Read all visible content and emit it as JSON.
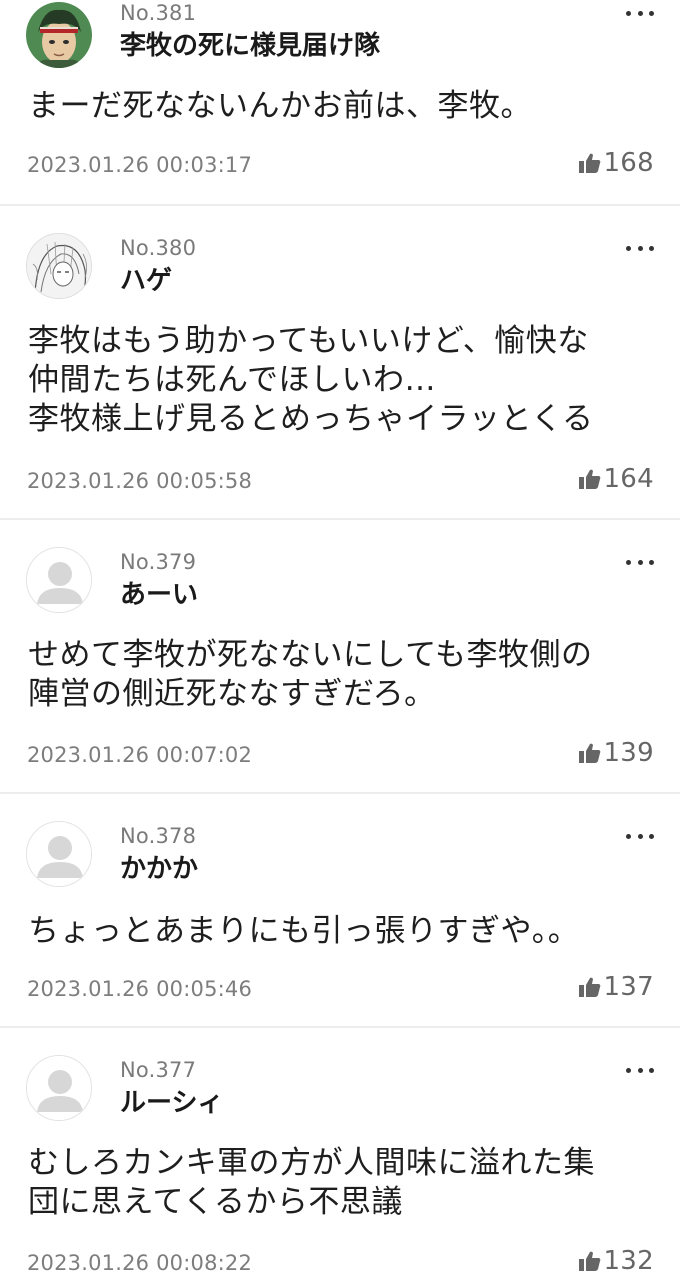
{
  "accent": {
    "text": "#1e1e1e",
    "meta": "#7d7d7d",
    "divider": "#ececec",
    "default_avatar": "#d7d7d7"
  },
  "comments": [
    {
      "number": "No.381",
      "author": "李牧の死に様見届け隊",
      "avatar": "portrait-avatar-green",
      "text": "まーだ死なないんかお前は、李牧。",
      "date": "2023.01.26 00:03:17",
      "likes": "168"
    },
    {
      "number": "No.380",
      "author": "ハゲ",
      "avatar": "manga-sketch-avatar",
      "text": "李牧はもう助かってもいいけど、愉快な\n仲間たちは死んでほしいわ…\n李牧様上げ見るとめっちゃイラッとくる",
      "date": "2023.01.26 00:05:58",
      "likes": "164"
    },
    {
      "number": "No.379",
      "author": "あーい",
      "avatar": "default-user-avatar",
      "text": "せめて李牧が死なないにしても李牧側の\n陣営の側近死ななすぎだろ。",
      "date": "2023.01.26 00:07:02",
      "likes": "139"
    },
    {
      "number": "No.378",
      "author": "かかか",
      "avatar": "default-user-avatar",
      "text": "ちょっとあまりにも引っ張りすぎや。。",
      "date": "2023.01.26 00:05:46",
      "likes": "137"
    },
    {
      "number": "No.377",
      "author": "ルーシィ",
      "avatar": "default-user-avatar",
      "text": "むしろカンキ軍の方が人間味に溢れた集\n団に思えてくるから不思議",
      "date": "2023.01.26 00:08:22",
      "likes": "132"
    }
  ]
}
